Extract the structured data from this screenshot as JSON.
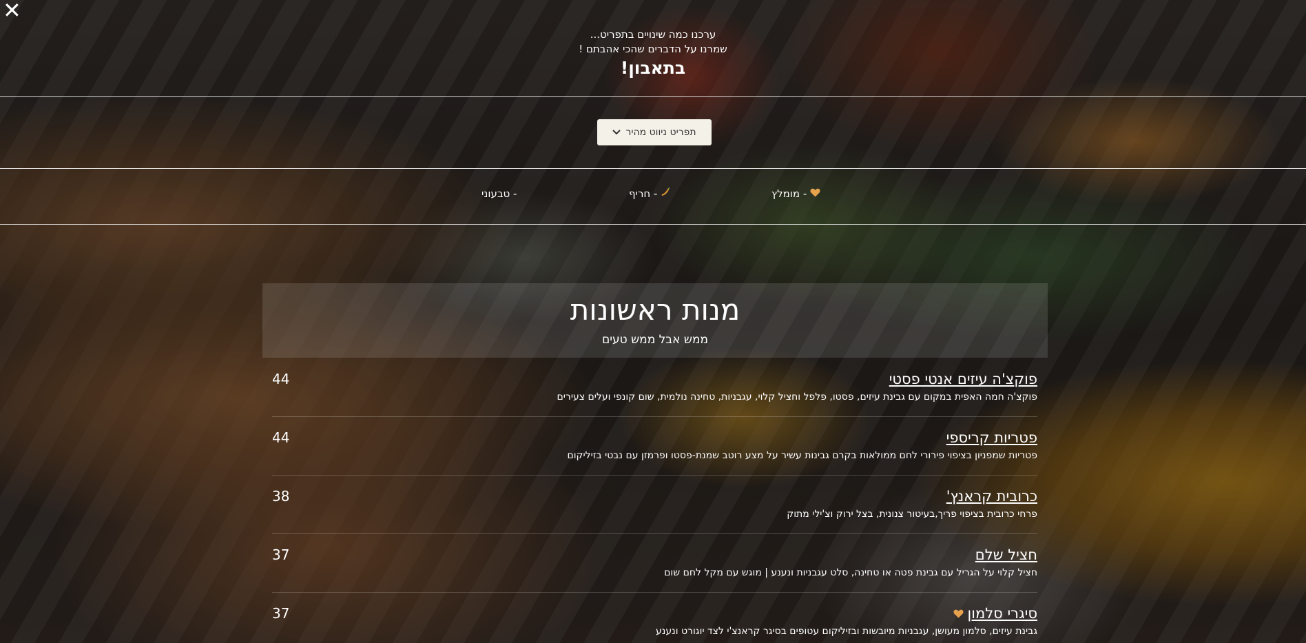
{
  "close": {
    "label": "✕"
  },
  "intro": {
    "line1": "ערכנו כמה שינויים בתפריט...",
    "line2": "שמרנו על הדברים שהכי אהבתם !",
    "headline": "בתאבון!"
  },
  "quick_nav": {
    "label": "תפריט ניווט מהיר",
    "icon": "chevron-down-icon"
  },
  "legend": {
    "recommended": {
      "icon": "heart-icon",
      "label": "- מומלץ"
    },
    "spicy": {
      "icon": "chili-icon",
      "label": "- חריף"
    },
    "vegan": {
      "icon": "leaf-icon",
      "label": "- טבעוני"
    }
  },
  "section": {
    "title": "מנות ראשונות",
    "subtitle": "ממש אבל ממש טעים"
  },
  "items": [
    {
      "name": "פוקצ'ה עיזים אנטי פסטי",
      "desc": "פוקצ'ה חמה האפית במקום עם גבינת עיזים, פסטו, פלפל וחציל קלוי, עגבניות, טחינה נולמית, שום קונפי ועלים צעירים",
      "price": "44",
      "tag": ""
    },
    {
      "name": "פטריות קריספי",
      "desc": "פטריות שמפניון בציפוי פירורי לחם ממולאות בקרם גבינות עשיר על מצע רוטב שמנת-פסטו ופרמזן עם נבטי בזיליקום",
      "price": "44",
      "tag": ""
    },
    {
      "name": "כרובית קראנץ'",
      "desc": "פרחי כרובית בציפוי פריך,בעיטור צנונית, בצל ירוק וצ'ילי מתוק",
      "price": "38",
      "tag": ""
    },
    {
      "name": "חציל שלם",
      "desc": "חציל קלוי על הגריל עם גבינת פטה או טחינה, סלט עגבניות ונענע | מוגש עם מקל לחם שום",
      "price": "37",
      "tag": ""
    },
    {
      "name": "סיגרי סלמון",
      "desc": "גבינת עיזים, סלמון מעושן, עגבניות מיובשות ובזיליקום עטופים בסיגר קראנצ'י לצד יוגורט ונענע",
      "price": "37",
      "tag": "heart-icon"
    }
  ],
  "colors": {
    "heart": "#e7a24d",
    "chili": "#d8902e",
    "button_bg": "#f4f1e8"
  }
}
